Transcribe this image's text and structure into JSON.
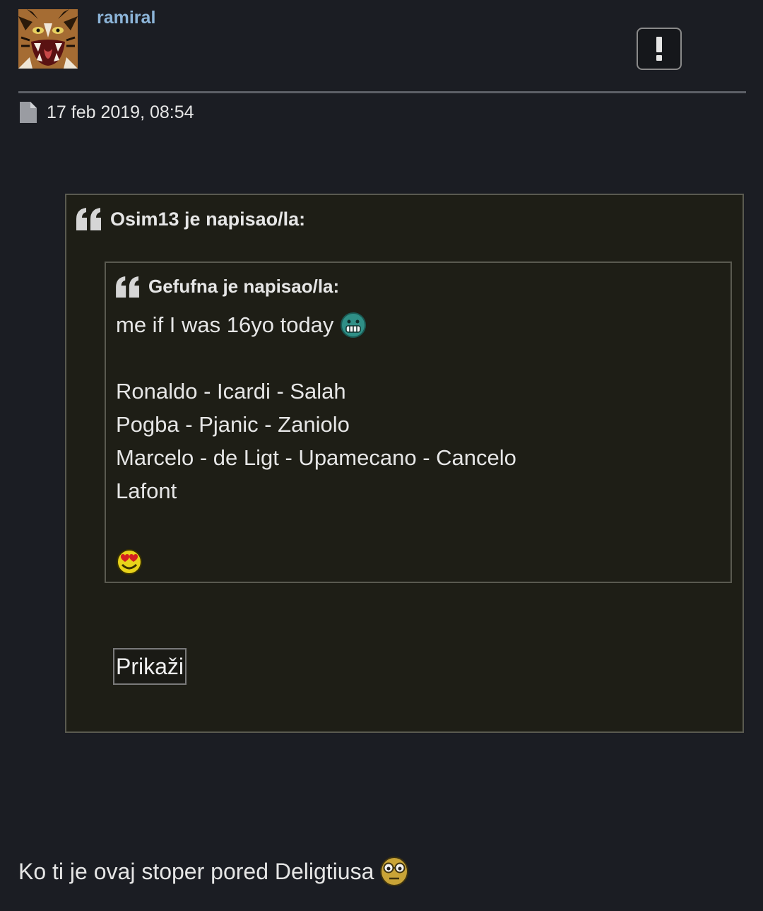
{
  "post": {
    "username": "ramiral",
    "avatar_icon": "tiger-avatar-icon",
    "report_icon": "exclamation-icon",
    "date_icon": "document-icon",
    "date": "17 feb 2019, 08:54"
  },
  "quote_outer": {
    "author": "Osim13 je napisao/la:",
    "quote_icon": "quote-mark-icon"
  },
  "quote_inner": {
    "author": "Gefufna je napisao/la:",
    "quote_icon": "quote-mark-icon",
    "lines": [
      "me if I was 16yo today",
      "",
      "Ronaldo - Icardi - Salah",
      "Pogba - Pjanic - Zaniolo",
      "Marcelo - de Ligt - Upamecano - Cancelo",
      "Lafont"
    ],
    "emoji_grin": "grin-emoji-icon",
    "emoji_hearts": "heart-eyes-emoji-icon"
  },
  "spoiler": {
    "button_label": "Prikaži"
  },
  "reply": {
    "text": "Ko ti je ovaj stoper pored Deligtiusa",
    "emoji": "nerd-glasses-emoji-icon"
  },
  "colors": {
    "background": "#1b1d23",
    "username": "#8cb4d8",
    "quote_bg": "#1e1e16",
    "quote_border": "#5a5a50"
  }
}
